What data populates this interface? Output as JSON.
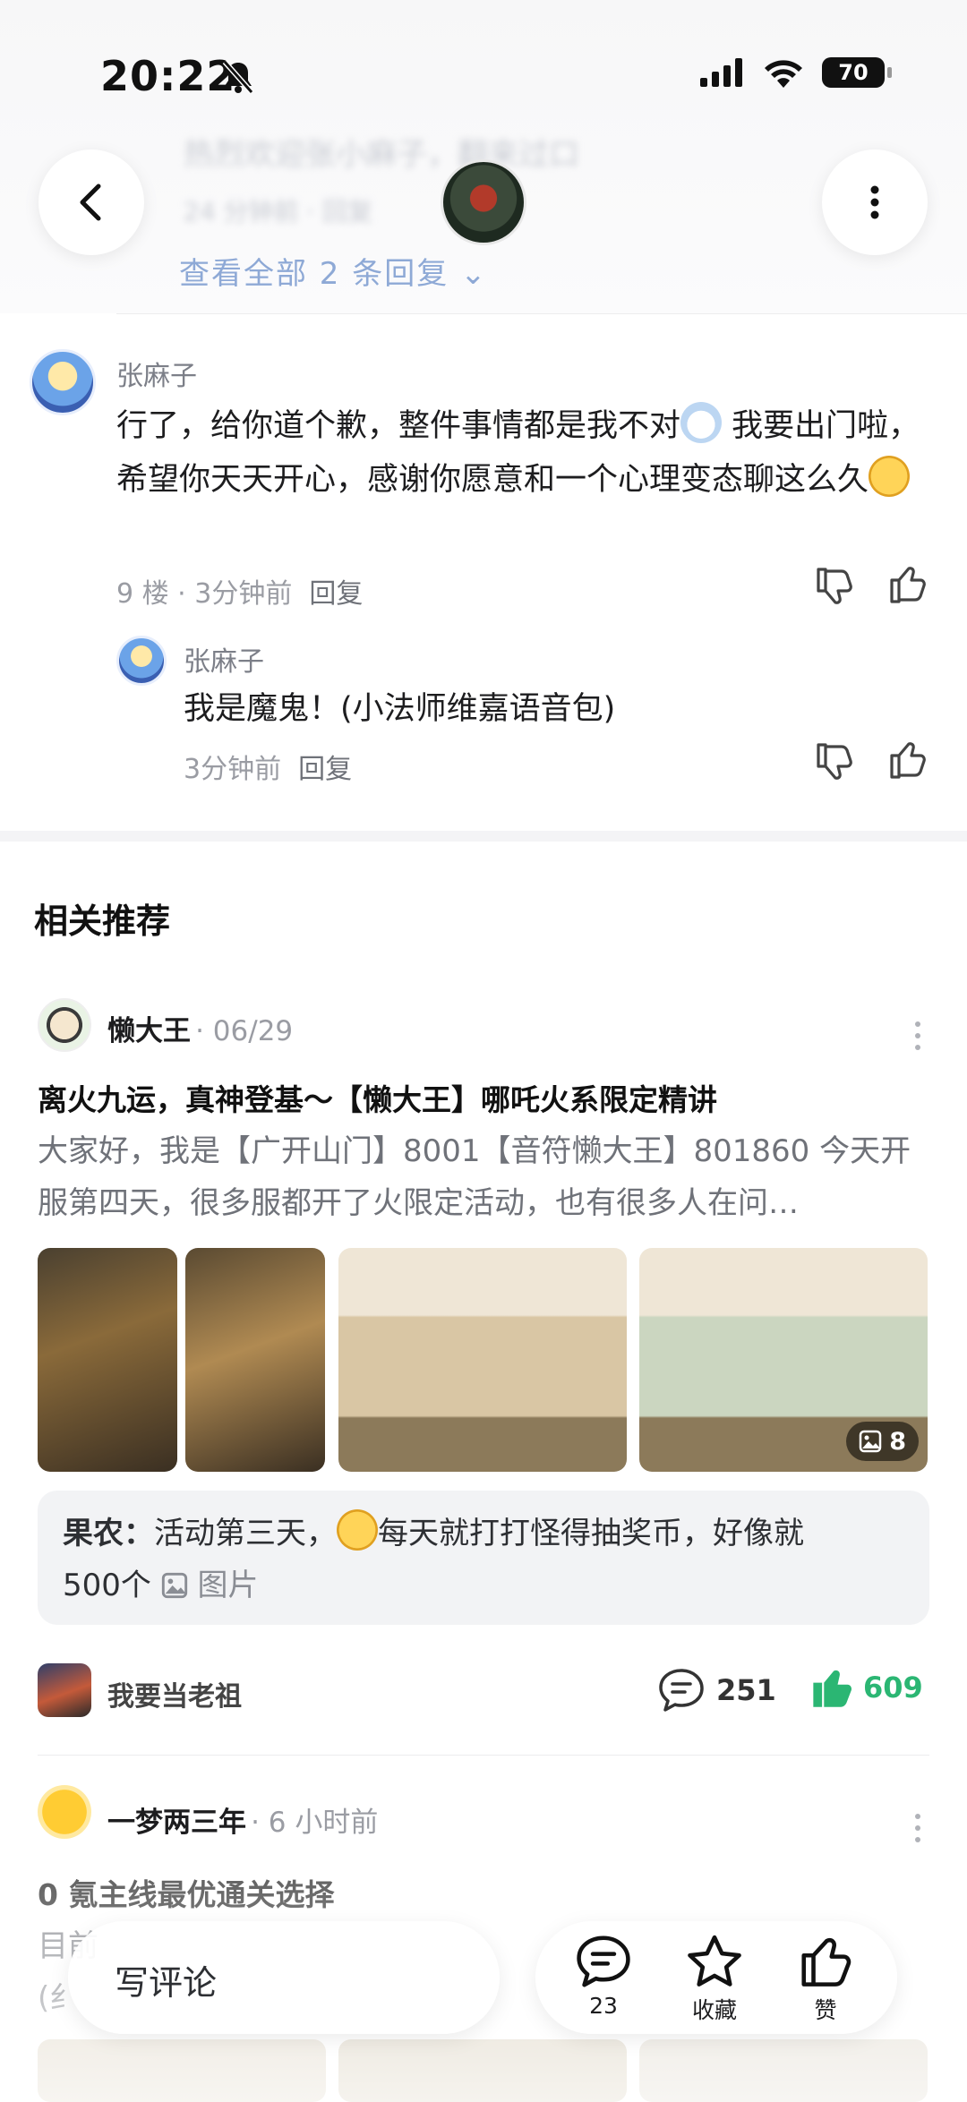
{
  "status_bar": {
    "time": "20:22",
    "battery": "70"
  },
  "header": {
    "prev_reply_link": "查看全部 2 条回复"
  },
  "comments": [
    {
      "author": "张麻子",
      "text_part1": "行了，给你道个歉，整件事情都是我不对",
      "text_part2": " 我要出门啦，希望你天天开心，感谢你愿意和一个心理变态聊这么久",
      "meta": "9 楼 · 3分钟前",
      "reply_label": "回复",
      "reply": {
        "author": "张麻子",
        "text": "我是魔鬼！(小法师维嘉语音包)",
        "meta": "3分钟前",
        "reply_label": "回复"
      }
    }
  ],
  "related": {
    "title": "相关推荐",
    "posts": [
      {
        "author": "懒大王",
        "date": "· 06/29",
        "title": "离火九运，真神登基～【懒大王】哪吒火系限定精讲",
        "excerpt": "大家好，我是【广开山门】8001【音符懒大王】801860  今天开服第四天，很多服都开了火限定活动，也有很多人在问…",
        "image_count": "8",
        "top_comment": {
          "author": "果农：",
          "text_part1": "活动第三天，",
          "text_part2": "每天就打打怪得抽奖币，好像就",
          "text_part3": "500个",
          "image_label": "图片"
        },
        "circle": "我要当老祖",
        "comments": "251",
        "likes": "609",
        "like_color": "#2bb673"
      },
      {
        "author": "一梦两三年",
        "date": "· 6 小时前",
        "title": "0 氪主线最优通关选择",
        "excerpt_line1": "目前",
        "excerpt_line2": "(纟"
      }
    ]
  },
  "bottom_bar": {
    "input_placeholder": "写评论",
    "comment_count": "23",
    "favorite_label": "收藏",
    "like_label": "赞"
  }
}
